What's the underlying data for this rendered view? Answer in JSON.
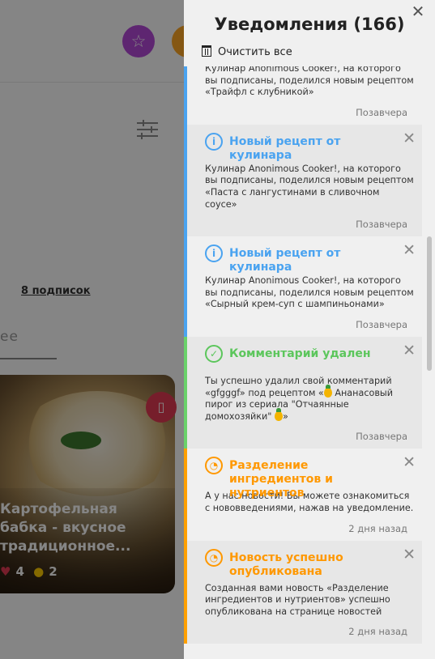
{
  "background": {
    "subscriptions_link": "8 подписок",
    "more_tab": "ее",
    "card": {
      "title_line1": "Картофельная",
      "title_line2": "бабка - вкусное",
      "title_line3": "традиционное...",
      "likes": "4",
      "cooks": "2"
    }
  },
  "panel": {
    "title": "Уведомления (166)",
    "clear_label": "Очистить все",
    "notifications": [
      {
        "title": "",
        "text": "Кулинар Anonimous Cooker!, на которого вы подписаны, поделился новым рецептом «Трайфл с клубникой»",
        "time": "Позавчера"
      },
      {
        "title": "Новый рецепт от кулинара",
        "text": "Кулинар Anonimous Cooker!, на которого вы подписаны, поделился новым рецептом «Паста с лангустинами в сливочном соусе»",
        "time": "Позавчера"
      },
      {
        "title": "Новый рецепт от кулинара",
        "text": "Кулинар Anonimous Cooker!, на которого вы подписаны, поделился новым рецептом «Сырный крем-суп с шампиньонами»",
        "time": "Позавчера"
      },
      {
        "title": "Комментарий удален",
        "text_a": "Ты успешно удалил свой комментарий «gfgggf» под рецептом «",
        "text_b": " Ананасовый пирог из сериала \"Отчаянные домохозяйки\" ",
        "text_c": "»",
        "time": "Позавчера"
      },
      {
        "title": "Разделение ингредиентов и нутриентов",
        "text": "А у нас новости! Вы можете ознакомиться с нововведениями, нажав на уведомление.",
        "time": "2 дня назад"
      },
      {
        "title": "Новость успешно опубликована",
        "text": "Созданная вами новость «Разделение ингредиентов и нутриентов» успешно опубликована на странице новостей",
        "time": "2 дня назад"
      }
    ]
  },
  "colors": {
    "info_blue": "#4aa3f0",
    "success_green": "#5cc65c",
    "news_orange": "#ff9800",
    "favorites_purple": "#b54ad8",
    "bookmark_red": "#e23a53"
  }
}
